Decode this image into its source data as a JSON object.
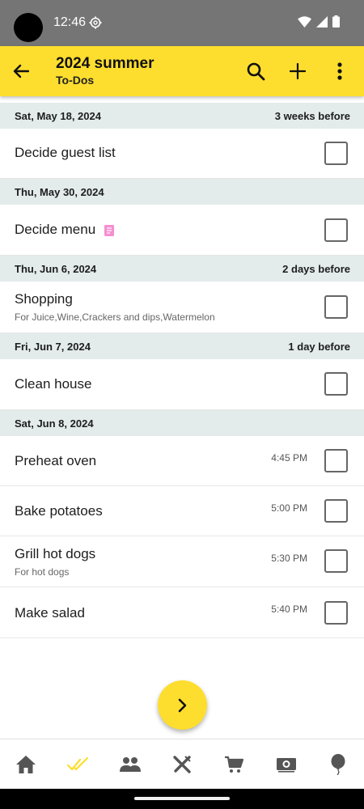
{
  "status": {
    "time": "12:46"
  },
  "app_bar": {
    "title": "2024 summer",
    "subtitle": "To-Dos"
  },
  "groups": [
    {
      "date": "Sat, May 18, 2024",
      "relative": "3 weeks before",
      "tasks": [
        {
          "title": "Decide guest list"
        }
      ]
    },
    {
      "date": "Thu, May 30, 2024",
      "relative": "",
      "tasks": [
        {
          "title": "Decide menu",
          "has_note": true
        }
      ]
    },
    {
      "date": "Thu, Jun 6, 2024",
      "relative": "2 days before",
      "tasks": [
        {
          "title": "Shopping",
          "subtitle": "For Juice,Wine,Crackers and dips,Watermelon"
        }
      ]
    },
    {
      "date": "Fri, Jun 7, 2024",
      "relative": "1 day before",
      "tasks": [
        {
          "title": "Clean house"
        }
      ]
    },
    {
      "date": "Sat, Jun 8, 2024",
      "relative": "",
      "tasks": [
        {
          "title": "Preheat oven",
          "time": "4:45 PM"
        },
        {
          "title": "Bake potatoes",
          "time": "5:00 PM"
        },
        {
          "title": "Grill hot dogs",
          "time": "5:30 PM",
          "subtitle": "For hot dogs"
        },
        {
          "title": "Make salad",
          "time": "5:40 PM"
        }
      ]
    }
  ],
  "colors": {
    "accent": "#fdde2e",
    "date_header_bg": "#e3ebeb",
    "status_bar": "#757575"
  },
  "icons": {
    "app_bar": [
      "back-arrow-icon",
      "search-icon",
      "plus-icon",
      "more-vert-icon"
    ],
    "fab": "chevron-right-icon",
    "bottom_nav": [
      "home-icon",
      "todos-check-icon",
      "people-icon",
      "utensils-icon",
      "cart-icon",
      "money-icon",
      "balloon-icon"
    ]
  },
  "bottom_nav_active": "todos-check-icon"
}
